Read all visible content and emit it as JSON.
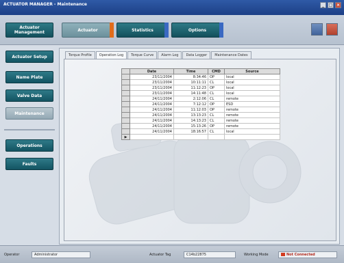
{
  "window": {
    "title": "ACTUATOR MANAGER - Maintenance"
  },
  "top_tabs": [
    {
      "label": "Actuator Management"
    },
    {
      "label": "Actuator"
    },
    {
      "label": "Statistics"
    },
    {
      "label": "Options"
    }
  ],
  "sidebar": {
    "items": [
      {
        "label": "Actuator Setup"
      },
      {
        "label": "Name Plate"
      },
      {
        "label": "Valve Data"
      },
      {
        "label": "Maintenance"
      },
      {
        "label": "Operations"
      },
      {
        "label": "Faults"
      }
    ]
  },
  "content_tabs": [
    {
      "label": "Torque Profile"
    },
    {
      "label": "Operation Log"
    },
    {
      "label": "Torque Curve"
    },
    {
      "label": "Alarm Log"
    },
    {
      "label": "Data Logger"
    },
    {
      "label": "Maintenance Dates"
    }
  ],
  "log_table": {
    "columns": [
      "Date",
      "Time",
      "CMD",
      "Source"
    ],
    "rows": [
      [
        "23/11/2004",
        "8:34:46",
        "OP",
        "local"
      ],
      [
        "23/11/2004",
        "10:11:11",
        "CL",
        "local"
      ],
      [
        "23/11/2004",
        "11:12:23",
        "OP",
        "local"
      ],
      [
        "23/11/2004",
        "14:11:48",
        "CL",
        "local"
      ],
      [
        "24/11/2004",
        "2:12:06",
        "CL",
        "remote"
      ],
      [
        "24/11/2004",
        "7:12:12",
        "OP",
        "ESD"
      ],
      [
        "24/11/2004",
        "11:12:03",
        "OP",
        "remote"
      ],
      [
        "24/11/2004",
        "13:13:23",
        "CL",
        "remote"
      ],
      [
        "24/11/2004",
        "14:13:23",
        "CL",
        "remote"
      ],
      [
        "24/11/2004",
        "15:13:26",
        "OP",
        "remote"
      ],
      [
        "24/11/2004",
        "18:16:57",
        "CL",
        "local"
      ]
    ]
  },
  "status": {
    "operator_label": "Operator",
    "operator_value": "Administrator",
    "tag_label": "Actuator Tag",
    "tag_value": "C14b22875",
    "mode_label": "Working Mode",
    "connection": "Not Connected"
  },
  "colors": {
    "accent_orange": "#e06c1a",
    "accent_blue": "#3a69c2",
    "teal": "#135462",
    "status_red": "#d23b1f"
  }
}
